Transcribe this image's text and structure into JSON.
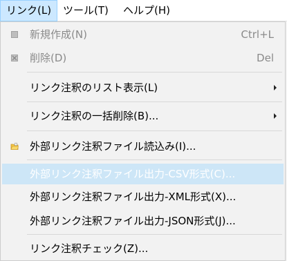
{
  "menubar": {
    "items": [
      {
        "label": "リンク(L)"
      },
      {
        "label": "ツール(T)"
      },
      {
        "label": "ヘルプ(H)"
      }
    ]
  },
  "menu": {
    "items": [
      {
        "label": "新規作成(N)",
        "shortcut": "Ctrl+L",
        "icon": "new-document-icon"
      },
      {
        "label": "削除(D)",
        "shortcut": "Del",
        "icon": "delete-icon"
      },
      {
        "label": "リンク注釈のリスト表示(L)",
        "icon": ""
      },
      {
        "label": "リンク注釈の一括削除(B)...",
        "icon": ""
      },
      {
        "label": "外部リンク注釈ファイル読込み(I)...",
        "icon": "folder-open-icon"
      },
      {
        "label": "外部リンク注釈ファイル出力-CSV形式(C)...",
        "icon": ""
      },
      {
        "label": "外部リンク注釈ファイル出力-XML形式(X)...",
        "icon": ""
      },
      {
        "label": "外部リンク注釈ファイル出力-JSON形式(J)...",
        "icon": ""
      },
      {
        "label": "リンク注釈チェック(Z)...",
        "icon": ""
      }
    ]
  },
  "colors": {
    "menubar_active": "#cce8ff",
    "highlight": "#cde6f7",
    "disabled_text": "#8a8a8a"
  }
}
